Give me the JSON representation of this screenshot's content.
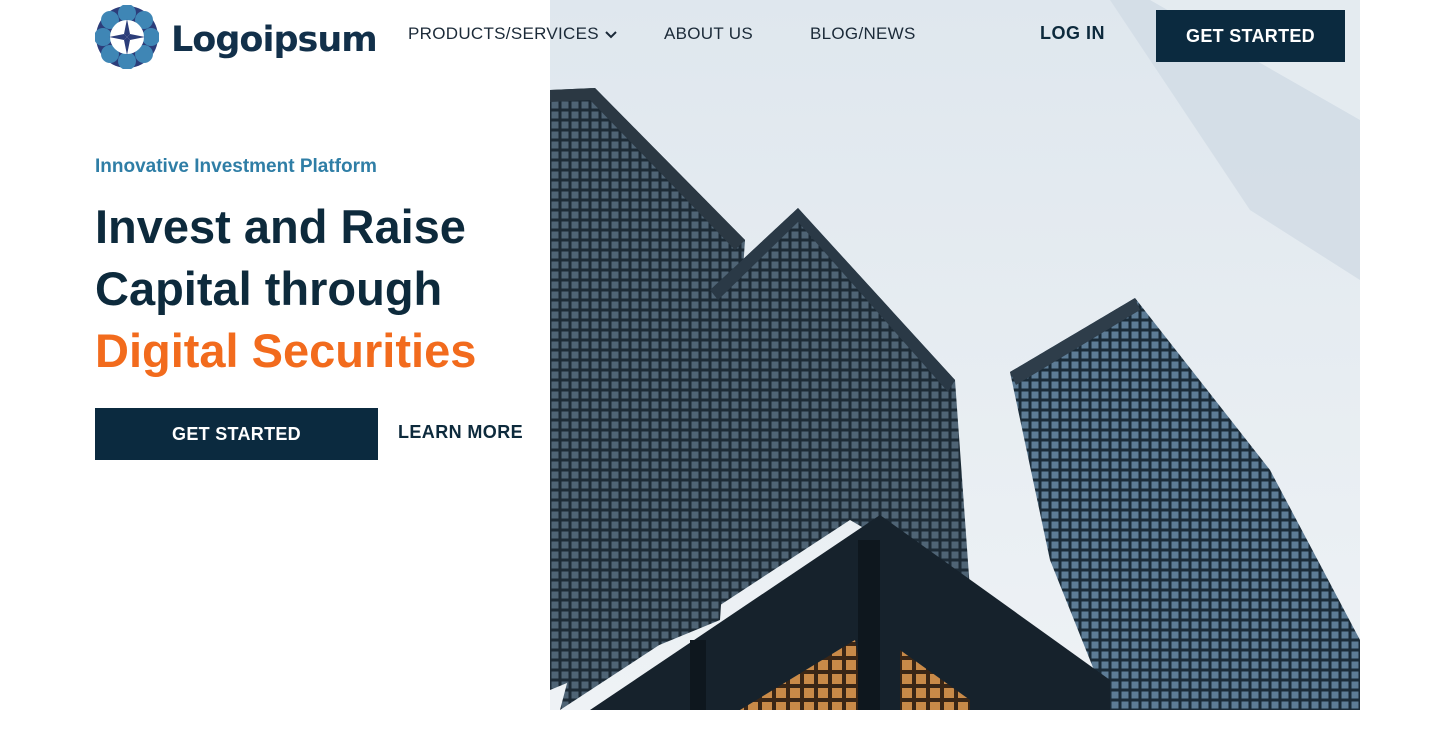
{
  "brand": {
    "name": "Logoipsum",
    "logo_icon": "sunburst-logo-icon",
    "colors": {
      "navy": "#0b2a3f",
      "blue": "#2f7ea6",
      "orange": "#f26b1d"
    }
  },
  "nav": {
    "items": [
      {
        "label": "PRODUCTS/SERVICES",
        "has_dropdown": true,
        "icon": "chevron-down-icon"
      },
      {
        "label": "ABOUT US"
      },
      {
        "label": "BLOG/NEWS"
      }
    ],
    "login_label": "LOG IN",
    "cta_label": "GET STARTED"
  },
  "hero": {
    "eyebrow": "Innovative Investment Platform",
    "headline_line1": "Invest and Raise",
    "headline_line2": "Capital through",
    "headline_accent": "Digital Securities",
    "primary_cta": "GET STARTED",
    "secondary_cta": "LEARN MORE",
    "image": "skyscrapers-photo"
  }
}
